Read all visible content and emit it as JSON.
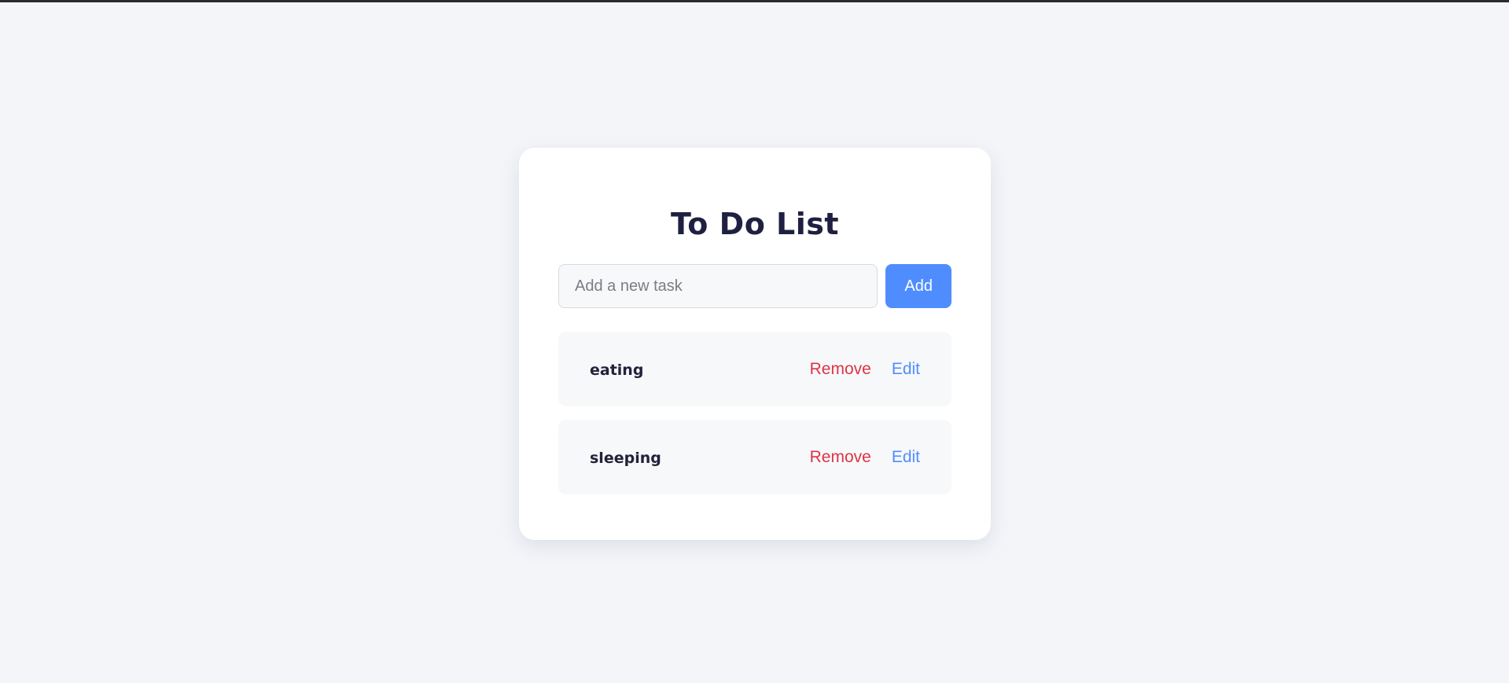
{
  "app": {
    "title": "To Do List"
  },
  "add_task": {
    "placeholder": "Add a new task",
    "value": "",
    "button_label": "Add"
  },
  "tasks": [
    {
      "text": "eating",
      "remove_label": "Remove",
      "edit_label": "Edit"
    },
    {
      "text": "sleeping",
      "remove_label": "Remove",
      "edit_label": "Edit"
    }
  ],
  "colors": {
    "background": "#f3f5f9",
    "card": "#ffffff",
    "title": "#1f2041",
    "accent": "#4f8dff",
    "danger": "#dc3545",
    "item_background": "#f7f8fa"
  }
}
